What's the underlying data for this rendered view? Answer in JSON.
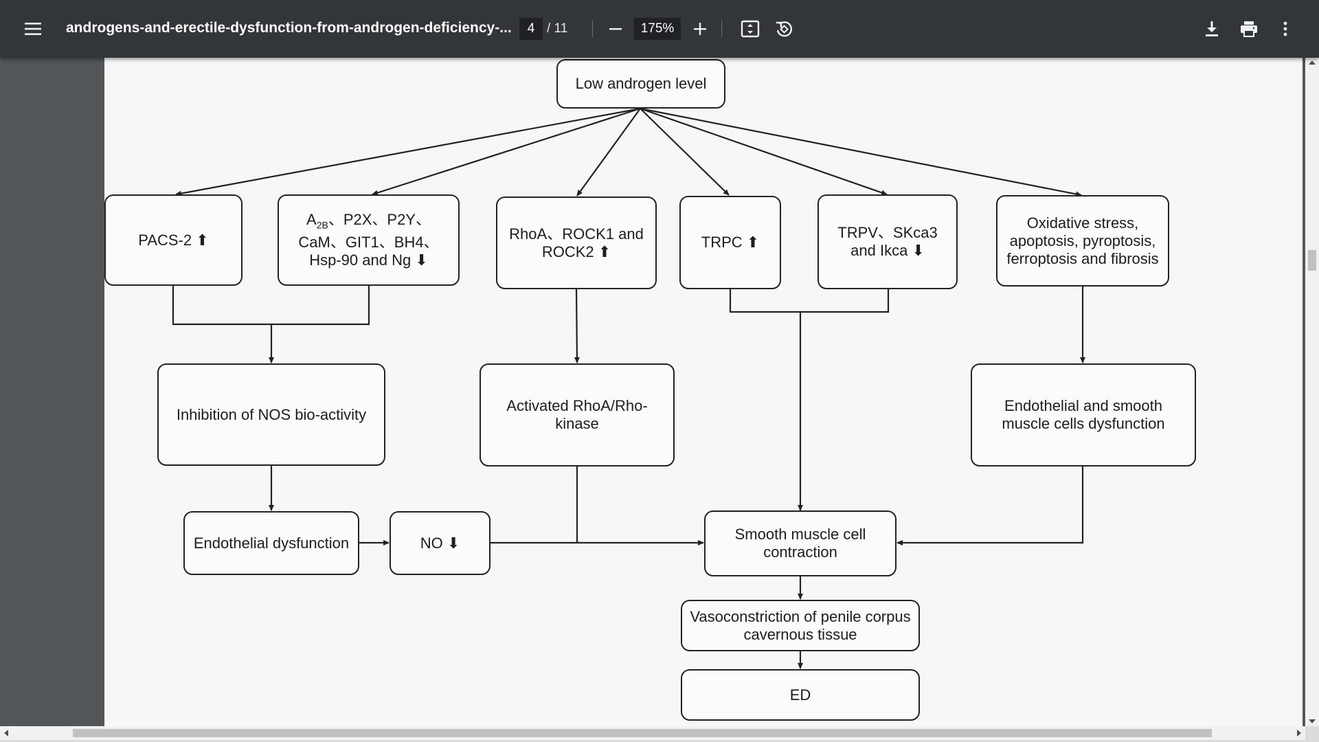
{
  "toolbar": {
    "menu_icon": "hamburger-menu-icon",
    "title": "androgens-and-erectile-dysfunction-from-androgen-deficiency-...",
    "current_page": "4",
    "page_total": "/ 11",
    "zoom": "175%",
    "icons": [
      "minus-icon",
      "plus-icon",
      "fit-page-icon",
      "rotate-icon",
      "download-icon",
      "print-icon",
      "more-vert-icon"
    ]
  },
  "diagram": {
    "root": "Low androgen level",
    "pacs2": "PACS-2 ⬆",
    "a2b_line1_pre": "A",
    "a2b_sub": "2B",
    "a2b_line1_post": "、P2X、P2Y、",
    "a2b_line2": "CaM、GIT1、BH4、",
    "a2b_line3": "Hsp-90 and Ng ⬇",
    "rhoa": "RhoA、ROCK1 and ROCK2 ⬆",
    "trpc": "TRPC ⬆",
    "trpv": "TRPV、SKca3 and Ikca ⬇",
    "oxidative": "Oxidative stress, apoptosis, pyroptosis, ferroptosis and fibrosis",
    "nos": "Inhibition of NOS bio-activity",
    "rho_kinase": "Activated RhoA/Rho-kinase",
    "endo_smooth": "Endothelial and smooth muscle cells dysfunction",
    "endo_dys": "Endothelial dysfunction",
    "no": "NO ⬇",
    "smc": "Smooth muscle cell contraction",
    "vaso": "Vasoconstriction of penile corpus cavernous tissue",
    "ed": "ED"
  }
}
